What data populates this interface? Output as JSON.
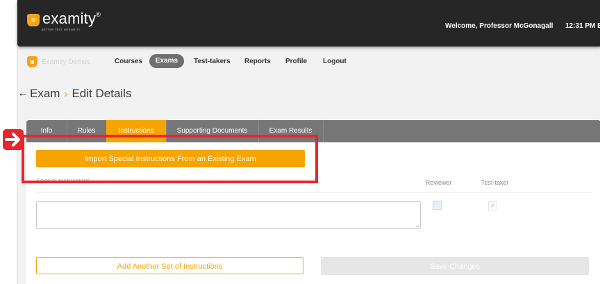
{
  "brand": {
    "name": "examity",
    "trademark": "®",
    "tagline": "BETTER TEST INTEGRITY"
  },
  "header": {
    "welcome": "Welcome, Professor McGonagall",
    "time": "12:31 PM  EST"
  },
  "nav": {
    "sub_brand": "Examity Demos",
    "items": [
      "Courses",
      "Exams",
      "Test-takers",
      "Reports",
      "Profile",
      "Logout"
    ],
    "active": "Exams"
  },
  "breadcrumb": {
    "back_icon": "left-arrow-icon",
    "parent": "Exam",
    "separator": "›",
    "current": "Edit Details"
  },
  "tabs": [
    {
      "label": "Info"
    },
    {
      "label": "Rules"
    },
    {
      "label": "Instructions"
    },
    {
      "label": "Supporting Documents"
    },
    {
      "label": "Exam Results"
    }
  ],
  "active_tab": "Instructions",
  "instructions": {
    "import_button": "Import Special Instructions From an Existing Exam",
    "section_label": "Special Instructions",
    "columns": {
      "reviewer": "Reviewer",
      "test_taker": "Test-taker"
    },
    "text_value": "",
    "reviewer_checked": false,
    "test_taker_checked": true,
    "add_button": "Add Another Set of Instructions",
    "save_button": "Save Changes"
  },
  "colors": {
    "accent": "#f5a400",
    "header": "#262626",
    "tabbar": "#777777",
    "annotation": "#e8262d"
  }
}
